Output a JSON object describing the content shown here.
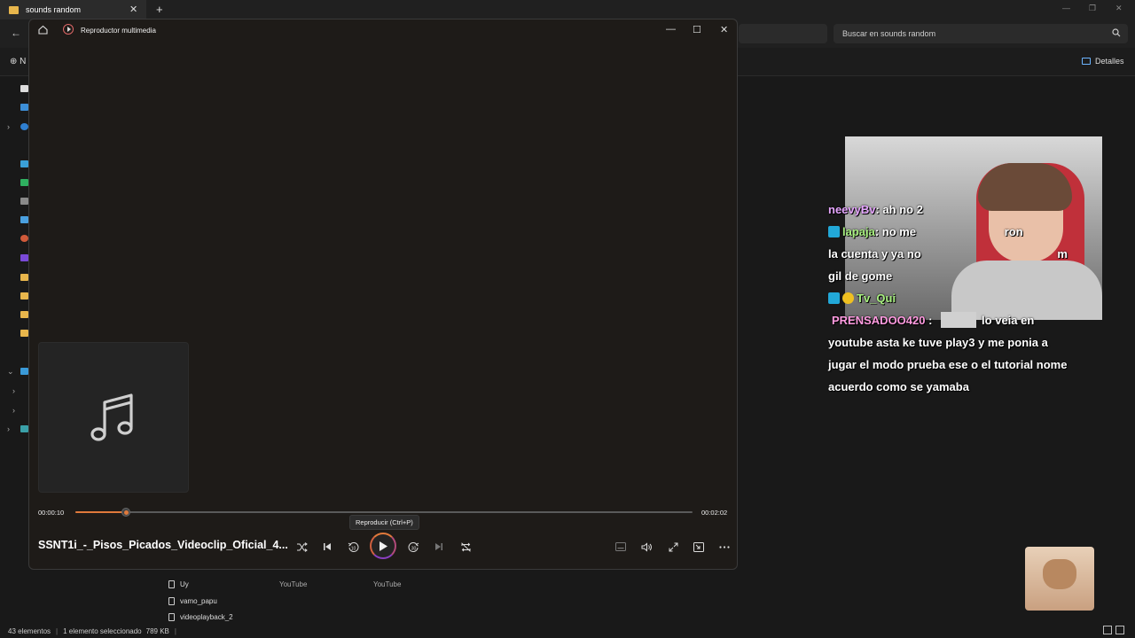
{
  "explorer": {
    "tab_title": "sounds random",
    "search_placeholder": "Buscar en sounds random",
    "new_label": "N",
    "details_label": "Detalles",
    "files": [
      {
        "name": "Uy",
        "col1": "YouTube",
        "col2": "YouTube"
      },
      {
        "name": "vamo_papu",
        "col1": "",
        "col2": ""
      },
      {
        "name": "videoplayback_2",
        "col1": "",
        "col2": ""
      }
    ],
    "status": {
      "count": "43 elementos",
      "selected": "1 elemento seleccionado",
      "size": "789 KB"
    }
  },
  "player": {
    "app_name": "Reproductor multimedia",
    "current_time": "00:00:10",
    "total_time": "00:02:02",
    "progress_fraction": 0.082,
    "tooltip": "Reproducir (Ctrl+P)",
    "song_title": "SSNT1i_-_Pisos_Picados_Videoclip_Oficial_4..."
  },
  "overlay": {
    "chat": [
      {
        "user": "neevyBv",
        "text": ": ah no 2 "
      },
      {
        "user": "lapaja",
        "text": ": no me ",
        "cont": "ron",
        "line2": "la cuenta y ya no ",
        "line2b": "m",
        "line3": "gil de gome"
      },
      {
        "user": "Tv_Qui",
        "text": ""
      },
      {
        "user": "PRENSADOO420",
        "text": " : ",
        "after": "lo veia en",
        "line2": "youtube asta ke tuve play3 y me ponia a",
        "line3": "jugar el modo prueba ese o el tutorial nome",
        "line4": "acuerdo como se yamaba"
      }
    ]
  }
}
